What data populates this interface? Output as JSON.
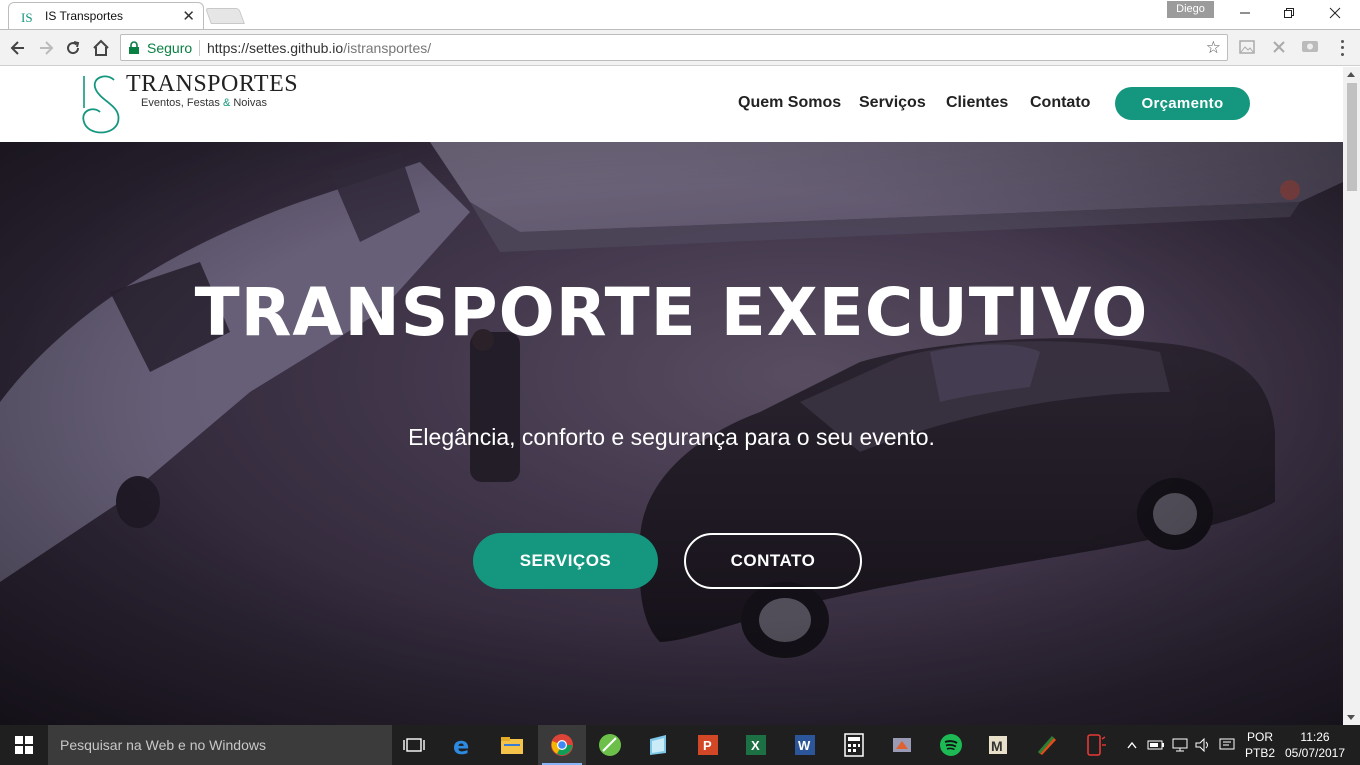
{
  "browser": {
    "tab_title": "IS Transportes",
    "tab_close": "✕",
    "profile_name": "Diego",
    "security_label": "Seguro",
    "url_host": "https://settes.github.io",
    "url_path": "/istransportes/",
    "star": "☆"
  },
  "site": {
    "logo_name": "TRANSPORTES",
    "logo_tag_part1": "Eventos, Festas",
    "logo_tag_amp": "&",
    "logo_tag_part2": "Noivas",
    "nav": [
      "Quem Somos",
      "Serviços",
      "Clientes",
      "Contato"
    ],
    "cta_label": "Orçamento",
    "accent_color": "#14977e"
  },
  "hero": {
    "title": "TRANSPORTE EXECUTIVO",
    "subtitle": "Elegância, conforto e segurança para o seu evento.",
    "primary_button": "SERVIÇOS",
    "secondary_button": "CONTATO"
  },
  "taskbar": {
    "search_placeholder": "Pesquisar na Web e no Windows",
    "lang_line1": "POR",
    "lang_line2": "PTB2",
    "time": "11:26",
    "date": "05/07/2017",
    "tray_chevron": "^",
    "pinned_apps": [
      "task-view-icon",
      "edge-icon",
      "file-explorer-icon",
      "chrome-icon",
      "app-green-icon",
      "app-notes-icon",
      "powerpoint-icon",
      "excel-icon",
      "word-icon",
      "calculator-icon",
      "app-media-icon",
      "spotify-icon",
      "app-m-icon",
      "app-pen-icon",
      "app-phone-icon"
    ]
  }
}
